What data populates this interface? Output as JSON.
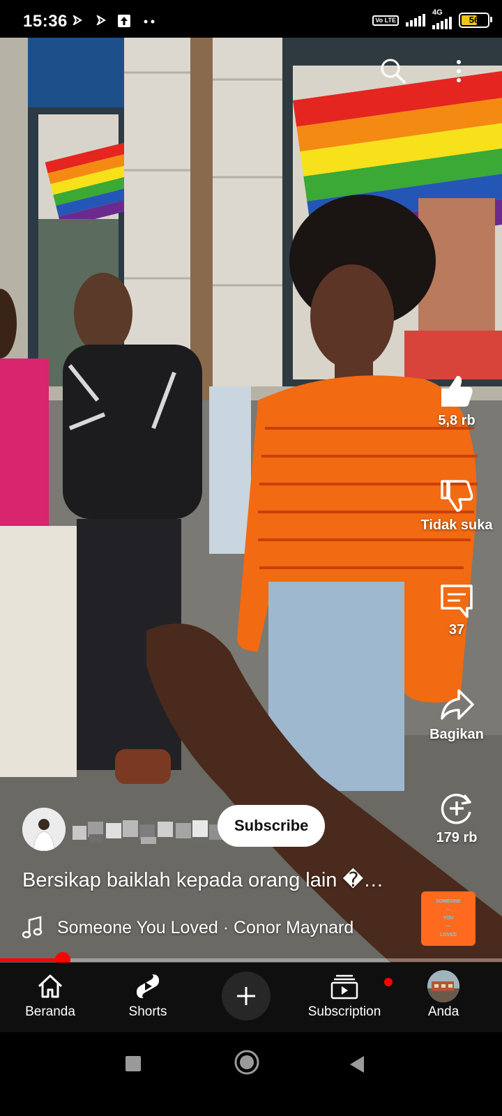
{
  "status_bar": {
    "time": "15:36",
    "network": "4G",
    "volte": "Vo LTE",
    "battery": "56"
  },
  "actions": {
    "like_count": "5,8 rb",
    "dislike_label": "Tidak suka",
    "comment_count": "37",
    "share_label": "Bagikan",
    "remix_count": "179 rb"
  },
  "video": {
    "subscribe_label": "Subscribe",
    "title": "Bersikap baiklah kepada orang lain �…",
    "music": "Someone You Loved · Conor Maynard",
    "progress_fraction": 0.125
  },
  "album_art": {
    "lines": [
      "SOMEONE",
      "—",
      "YOU",
      "—",
      "LOVED"
    ]
  },
  "nav": {
    "items": [
      {
        "label": "Beranda",
        "icon": "home-icon"
      },
      {
        "label": "Shorts",
        "icon": "shorts-icon"
      },
      {
        "label": "",
        "icon": "create-icon"
      },
      {
        "label": "Subscription",
        "icon": "subscriptions-icon"
      },
      {
        "label": "Anda",
        "icon": "avatar"
      }
    ]
  },
  "colors": {
    "accent_red": "#ff0000",
    "nav_bg": "#0f0f0f",
    "album_bg": "#ff6a1e"
  }
}
